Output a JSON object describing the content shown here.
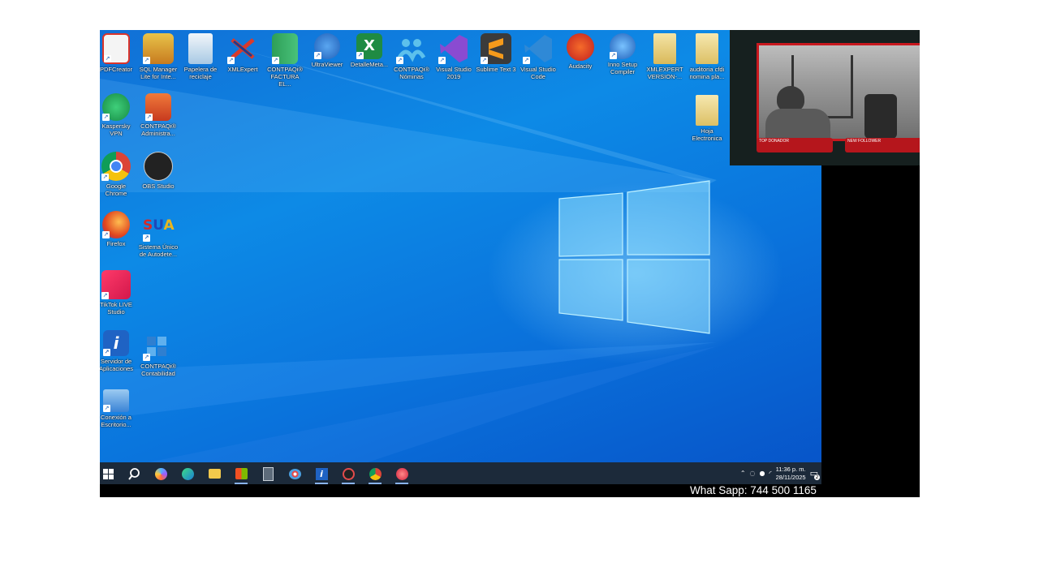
{
  "desktop_icons": [
    {
      "id": "pdfcreator",
      "label": "PDFCreator",
      "color": "#d9342b",
      "shortcut": true
    },
    {
      "id": "sqlmanager",
      "label": "SQL Manager Lite for Inte...",
      "color": "#e2a823",
      "shortcut": true
    },
    {
      "id": "recycle",
      "label": "Papelera de reciclaje",
      "color": "#9ec7e8",
      "shortcut": false
    },
    {
      "id": "xmlexpert",
      "label": "XMLExpert",
      "color": "#243b8a",
      "shortcut": true
    },
    {
      "id": "contpaqi-factura",
      "label": "CONTPAQi® FACTURA EL...",
      "color": "#2e9e57",
      "shortcut": true
    },
    {
      "id": "ultraviewer",
      "label": "UltraViewer",
      "color": "#2c78d3",
      "shortcut": true
    },
    {
      "id": "detallemeta",
      "label": "DetalleMeta...",
      "color": "#1f8b43",
      "shortcut": true
    },
    {
      "id": "contpaqi-nominas",
      "label": "CONTPAQi® Nóminas",
      "color": "#3aa5d9",
      "shortcut": true
    },
    {
      "id": "vs2019",
      "label": "Visual Studio 2019",
      "color": "#7b3fb7",
      "shortcut": true
    },
    {
      "id": "sublime",
      "label": "Sublime Text 3",
      "color": "#3b3b3b",
      "shortcut": true
    },
    {
      "id": "vscode",
      "label": "Visual Studio Code",
      "color": "#2f89d6",
      "shortcut": true
    },
    {
      "id": "audacity",
      "label": "Audacity",
      "color": "#e04a1c",
      "shortcut": false
    },
    {
      "id": "innosetup",
      "label": "Inno Setup Compiler",
      "color": "#2a6fc9",
      "shortcut": true
    },
    {
      "id": "xmlexpert-version",
      "label": "XMLEXPERT VERSION-...",
      "color": "#e9d48a",
      "shortcut": false
    },
    {
      "id": "auditoria",
      "label": "auditoria cfdi nomina pla...",
      "color": "#f0dc8c",
      "shortcut": false
    },
    {
      "id": "hoja",
      "label": "Hoja Electronica",
      "color": "#f0dc8c",
      "shortcut": false
    },
    {
      "id": "kaspersky",
      "label": "Kaspersky VPN",
      "color": "#1fa85a",
      "shortcut": true
    },
    {
      "id": "contpaqi-admin",
      "label": "CONTPAQi® Administra...",
      "color": "#d94a2a",
      "shortcut": true
    },
    {
      "id": "chrome",
      "label": "Google Chrome",
      "color": "#e0c43a",
      "shortcut": true
    },
    {
      "id": "obs",
      "label": "OBS Studio",
      "color": "#222222",
      "shortcut": false
    },
    {
      "id": "firefox",
      "label": "Firefox",
      "color": "#f07a1f",
      "shortcut": true
    },
    {
      "id": "sua",
      "label": "Sistema Único de Autodete...",
      "color": "#e7e3f5",
      "shortcut": true
    },
    {
      "id": "tiktok",
      "label": "TikTok LIVE Studio",
      "color": "#e8335a",
      "shortcut": true
    },
    {
      "id": "servidor",
      "label": "Servidor de Aplicaciones",
      "color": "#1f63c4",
      "shortcut": true
    },
    {
      "id": "contpaqi-cont",
      "label": "CONTPAQi® Contabilidad",
      "color": "#3b8fd6",
      "shortcut": true
    },
    {
      "id": "remote",
      "label": "Conexión a Escritorio...",
      "color": "#3a83d6",
      "shortcut": true
    }
  ],
  "taskbar": {
    "items": [
      "windows-start",
      "search",
      "copilot",
      "edge",
      "file-explorer",
      "store",
      "calculator",
      "paint",
      "servidor-aplicaciones",
      "obs",
      "chrome",
      "app"
    ],
    "clock_time": "11:36 p. m.",
    "clock_date": "28/11/2025",
    "notification_count": "2"
  },
  "webcam": {
    "left_bar_text": "TOP DONADOR",
    "right_bar_text": "NEW FOLLOWER"
  },
  "overlay_text": "What Sapp: 744 500 1165"
}
